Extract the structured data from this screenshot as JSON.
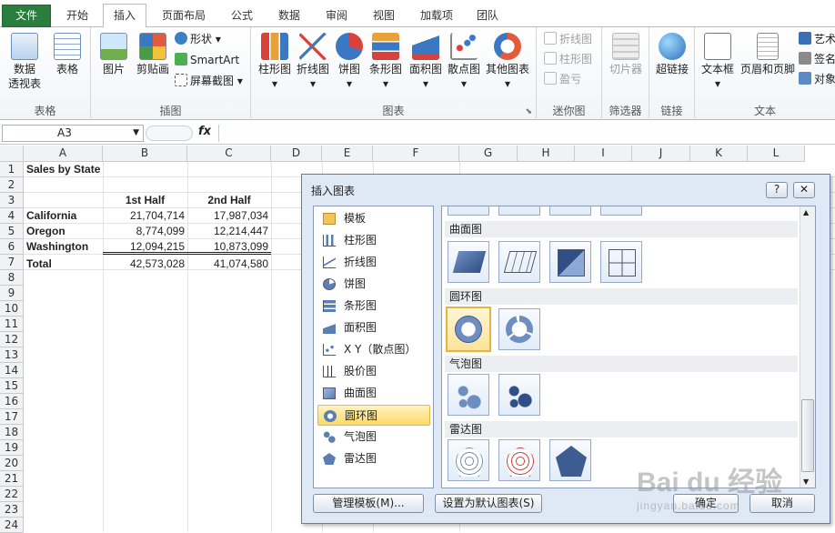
{
  "tabs": [
    "文件",
    "开始",
    "插入",
    "页面布局",
    "公式",
    "数据",
    "审阅",
    "视图",
    "加载项",
    "团队"
  ],
  "ribbon": {
    "groups": [
      "表格",
      "插图",
      "图表",
      "迷你图",
      "筛选器",
      "链接",
      "文本"
    ],
    "buttons": {
      "pivot": "数据",
      "pivot2": "透视表",
      "table": "表格",
      "picture": "图片",
      "clipart": "剪贴画",
      "shapes": "形状",
      "smartart": "SmartArt",
      "screenshot": "屏幕截图",
      "column": "柱形图",
      "line": "折线图",
      "pie": "饼图",
      "bar": "条形图",
      "area": "面积图",
      "scatter": "散点图",
      "other": "其他图表",
      "spark_line": "折线图",
      "spark_column": "柱形图",
      "spark_winloss": "盈亏",
      "slicer": "切片器",
      "hyperlink": "超链接",
      "textbox": "文本框",
      "headerfooter": "页眉和页脚",
      "wordart": "艺术",
      "signature": "签名",
      "object": "对象"
    }
  },
  "formula_bar": {
    "name_box": "A3",
    "fx": "fx",
    "formula": ""
  },
  "columns": [
    "A",
    "B",
    "C",
    "D",
    "E",
    "F",
    "G",
    "H",
    "I",
    "J",
    "K",
    "L"
  ],
  "rows": [
    "1",
    "2",
    "3",
    "4",
    "5",
    "6",
    "7",
    "8",
    "9",
    "10",
    "11",
    "12",
    "13",
    "14",
    "15",
    "16",
    "17",
    "18",
    "19",
    "20",
    "21",
    "22",
    "23",
    "24"
  ],
  "sheet": {
    "title": "Sales by State",
    "header_b": "1st Half",
    "header_c": "2nd Half",
    "data": [
      {
        "state": "California",
        "h1": "21,704,714",
        "h2": "17,987,034"
      },
      {
        "state": "Oregon",
        "h1": "8,774,099",
        "h2": "12,214,447"
      },
      {
        "state": "Washington",
        "h1": "12,094,215",
        "h2": "10,873,099"
      }
    ],
    "total": {
      "label": "Total",
      "h1": "42,573,028",
      "h2": "41,074,580"
    }
  },
  "dialog": {
    "title": "插入图表",
    "help": "?",
    "close": "✕",
    "categories": [
      "模板",
      "柱形图",
      "折线图",
      "饼图",
      "条形图",
      "面积图",
      "X Y（散点图）",
      "股价图",
      "曲面图",
      "圆环图",
      "气泡图",
      "雷达图"
    ],
    "selected_category": "圆环图",
    "sections": [
      "曲面图",
      "圆环图",
      "气泡图",
      "雷达图"
    ],
    "buttons": {
      "manage": "管理模板(M)...",
      "default": "设置为默认图表(S)",
      "ok": "确定",
      "cancel": "取消"
    }
  },
  "watermark": {
    "text": "Bai du 经验",
    "sub": "jingyan.baidu.com"
  }
}
